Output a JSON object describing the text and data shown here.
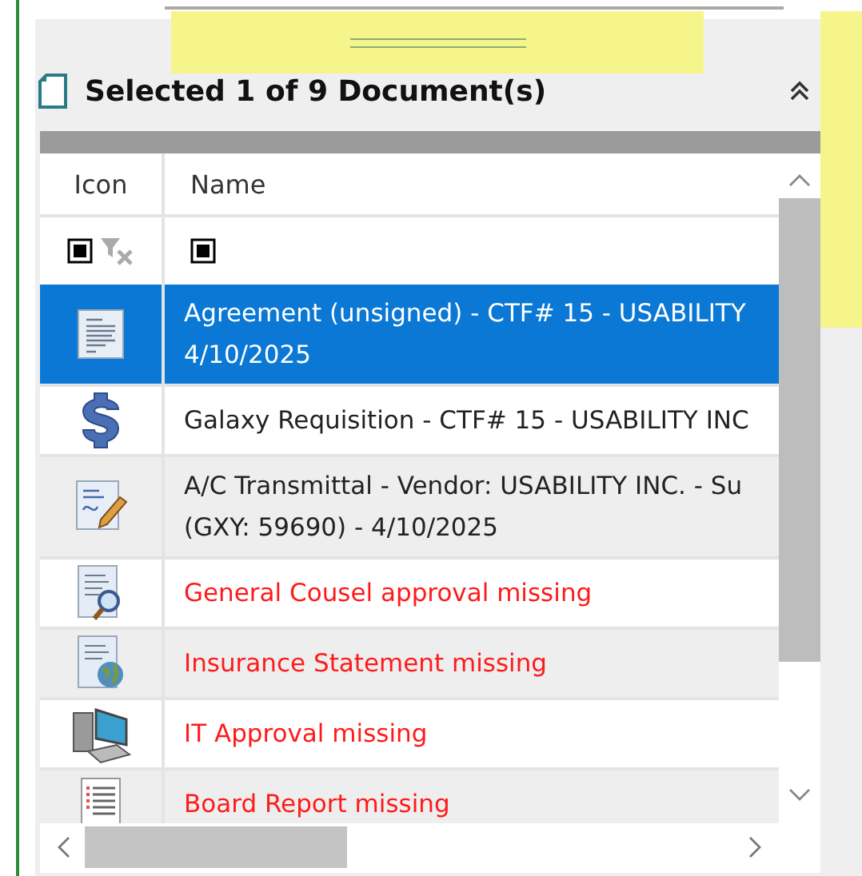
{
  "panel": {
    "title": "Selected 1 of 9 Document(s)"
  },
  "table": {
    "columns": [
      "Icon",
      "Name"
    ],
    "filter_row": [
      {
        "indeterminate": true
      },
      {
        "indeterminate": true
      }
    ],
    "rows": [
      {
        "kind": "agreement",
        "lines": [
          "Agreement (unsigned) - CTF# 15 - USABILITY",
          "4/10/2025"
        ],
        "selected": true,
        "missing": false
      },
      {
        "kind": "dollar",
        "lines": [
          "Galaxy Requisition - CTF# 15 - USABILITY INC"
        ],
        "selected": false,
        "missing": false
      },
      {
        "kind": "transmittal",
        "lines": [
          "A/C Transmittal - Vendor: USABILITY INC. - Su",
          "(GXY: 59690) - 4/10/2025"
        ],
        "selected": false,
        "missing": false
      },
      {
        "kind": "counsel",
        "lines": [
          "General Cousel approval missing"
        ],
        "selected": false,
        "missing": true
      },
      {
        "kind": "insurance",
        "lines": [
          "Insurance Statement missing"
        ],
        "selected": false,
        "missing": true
      },
      {
        "kind": "computer",
        "lines": [
          "IT Approval missing"
        ],
        "selected": false,
        "missing": true
      },
      {
        "kind": "report",
        "lines": [
          "Board Report missing"
        ],
        "selected": false,
        "missing": true
      }
    ]
  }
}
